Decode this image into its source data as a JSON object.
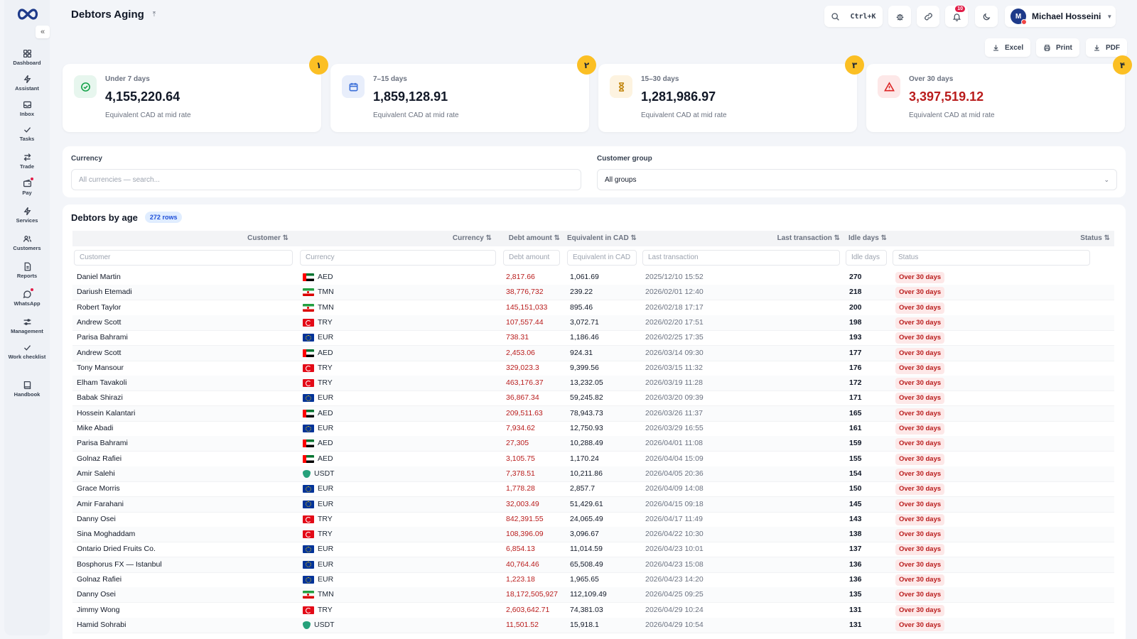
{
  "sidebar": {
    "collapse_glyph": "«",
    "items": [
      {
        "label": "Dashboard",
        "icon": "dashboard-icon",
        "dot": false
      },
      {
        "label": "Assistant",
        "icon": "bolt-icon",
        "dot": false
      },
      {
        "label": "Inbox",
        "icon": "inbox-icon",
        "dot": false
      },
      {
        "label": "Tasks",
        "icon": "check-icon",
        "dot": false
      },
      {
        "label": "Trade",
        "icon": "swap-icon",
        "dot": false
      },
      {
        "label": "Pay",
        "icon": "wallet-icon",
        "dot": true
      },
      {
        "label": "Services",
        "icon": "bolt-icon",
        "dot": false
      },
      {
        "label": "Customers",
        "icon": "users-icon",
        "dot": false
      },
      {
        "label": "Reports",
        "icon": "report-icon",
        "dot": false
      },
      {
        "label": "WhatsApp",
        "icon": "chat-icon",
        "dot": true
      },
      {
        "label": "Management",
        "icon": "sliders-icon",
        "dot": false
      },
      {
        "label": "Work checklist",
        "icon": "check-icon",
        "dot": false
      },
      {
        "label": "Handbook",
        "icon": "book-icon",
        "dot": false
      }
    ]
  },
  "header": {
    "title": "Debtors Aging",
    "search_shortcut": "Ctrl+K",
    "notifications_count": "10",
    "user_initial": "M",
    "user_name": "Michael Hosseini"
  },
  "exports": {
    "excel": "Excel",
    "print": "Print",
    "pdf": "PDF"
  },
  "cards": [
    {
      "badge": "١",
      "label": "Under 7 days",
      "value": "4,155,220.64",
      "sub": "Equivalent CAD at mid rate",
      "icon": "check-circle-icon",
      "accent": "#16a34a",
      "bg": "#e7f6ee",
      "red": false
    },
    {
      "badge": "٢",
      "label": "7–15 days",
      "value": "1,859,128.91",
      "sub": "Equivalent CAD at mid rate",
      "icon": "calendar-icon",
      "accent": "#3b6fd8",
      "bg": "#e8eefb",
      "red": false
    },
    {
      "badge": "٣",
      "label": "15–30 days",
      "value": "1,281,986.97",
      "sub": "Equivalent CAD at mid rate",
      "icon": "hourglass-icon",
      "accent": "#c2860e",
      "bg": "#fdf3e0",
      "red": false
    },
    {
      "badge": "۴",
      "label": "Over 30 days",
      "value": "3,397,519.12",
      "sub": "Equivalent CAD at mid rate",
      "icon": "warning-icon",
      "accent": "#dc2626",
      "bg": "#fde8e8",
      "red": true
    }
  ],
  "filters": {
    "currency_label": "Currency",
    "currency_placeholder": "All currencies — search...",
    "group_label": "Customer group",
    "group_value": "All groups"
  },
  "table": {
    "title": "Debtors by age",
    "rows_count": "272 rows",
    "columns": {
      "customer": "Customer ⇅",
      "currency": "Currency ⇅",
      "debt": "Debt amount ⇅",
      "equiv": "Equivalent in CAD ⇅",
      "last": "Last transaction ⇅",
      "idle": "Idle days ⇅",
      "status": "Status ⇅"
    },
    "filter_placeholders": {
      "customer": "Customer",
      "currency": "Currency",
      "debt": "Debt amount",
      "equiv": "Equivalent in CAD",
      "last": "Last transaction",
      "idle": "Idle days",
      "status": "Status"
    },
    "rows": [
      {
        "customer": "Daniel Martin",
        "currency": "AED",
        "flag": "aed",
        "debt": "2,817.66",
        "equiv": "1,061.69",
        "last": "2025/12/10 15:52",
        "idle": "270",
        "status": "Over 30 days"
      },
      {
        "customer": "Dariush Etemadi",
        "currency": "TMN",
        "flag": "tmn",
        "debt": "38,776,732",
        "equiv": "239.22",
        "last": "2026/02/01 12:40",
        "idle": "218",
        "status": "Over 30 days"
      },
      {
        "customer": "Robert Taylor",
        "currency": "TMN",
        "flag": "tmn",
        "debt": "145,151,033",
        "equiv": "895.46",
        "last": "2026/02/18 17:17",
        "idle": "200",
        "status": "Over 30 days"
      },
      {
        "customer": "Andrew Scott",
        "currency": "TRY",
        "flag": "try",
        "debt": "107,557.44",
        "equiv": "3,072.71",
        "last": "2026/02/20 17:51",
        "idle": "198",
        "status": "Over 30 days"
      },
      {
        "customer": "Parisa Bahrami",
        "currency": "EUR",
        "flag": "eur",
        "debt": "738.31",
        "equiv": "1,186.46",
        "last": "2026/02/25 17:35",
        "idle": "193",
        "status": "Over 30 days"
      },
      {
        "customer": "Andrew Scott",
        "currency": "AED",
        "flag": "aed",
        "debt": "2,453.06",
        "equiv": "924.31",
        "last": "2026/03/14 09:30",
        "idle": "177",
        "status": "Over 30 days"
      },
      {
        "customer": "Tony Mansour",
        "currency": "TRY",
        "flag": "try",
        "debt": "329,023.3",
        "equiv": "9,399.56",
        "last": "2026/03/15 11:32",
        "idle": "176",
        "status": "Over 30 days"
      },
      {
        "customer": "Elham Tavakoli",
        "currency": "TRY",
        "flag": "try",
        "debt": "463,176.37",
        "equiv": "13,232.05",
        "last": "2026/03/19 11:28",
        "idle": "172",
        "status": "Over 30 days"
      },
      {
        "customer": "Babak Shirazi",
        "currency": "EUR",
        "flag": "eur",
        "debt": "36,867.34",
        "equiv": "59,245.82",
        "last": "2026/03/20 09:39",
        "idle": "171",
        "status": "Over 30 days"
      },
      {
        "customer": "Hossein Kalantari",
        "currency": "AED",
        "flag": "aed",
        "debt": "209,511.63",
        "equiv": "78,943.73",
        "last": "2026/03/26 11:37",
        "idle": "165",
        "status": "Over 30 days"
      },
      {
        "customer": "Mike Abadi",
        "currency": "EUR",
        "flag": "eur",
        "debt": "7,934.62",
        "equiv": "12,750.93",
        "last": "2026/03/29 16:55",
        "idle": "161",
        "status": "Over 30 days"
      },
      {
        "customer": "Parisa Bahrami",
        "currency": "AED",
        "flag": "aed",
        "debt": "27,305",
        "equiv": "10,288.49",
        "last": "2026/04/01 11:08",
        "idle": "159",
        "status": "Over 30 days"
      },
      {
        "customer": "Golnaz Rafiei",
        "currency": "AED",
        "flag": "aed",
        "debt": "3,105.75",
        "equiv": "1,170.24",
        "last": "2026/04/04 15:09",
        "idle": "155",
        "status": "Over 30 days"
      },
      {
        "customer": "Amir Salehi",
        "currency": "USDT",
        "flag": "usdt",
        "debt": "7,378.51",
        "equiv": "10,211.86",
        "last": "2026/04/05 20:36",
        "idle": "154",
        "status": "Over 30 days"
      },
      {
        "customer": "Grace Morris",
        "currency": "EUR",
        "flag": "eur",
        "debt": "1,778.28",
        "equiv": "2,857.7",
        "last": "2026/04/09 14:08",
        "idle": "150",
        "status": "Over 30 days"
      },
      {
        "customer": "Amir Farahani",
        "currency": "EUR",
        "flag": "eur",
        "debt": "32,003.49",
        "equiv": "51,429.61",
        "last": "2026/04/15 09:18",
        "idle": "145",
        "status": "Over 30 days"
      },
      {
        "customer": "Danny Osei",
        "currency": "TRY",
        "flag": "try",
        "debt": "842,391.55",
        "equiv": "24,065.49",
        "last": "2026/04/17 11:49",
        "idle": "143",
        "status": "Over 30 days"
      },
      {
        "customer": "Sina Moghaddam",
        "currency": "TRY",
        "flag": "try",
        "debt": "108,396.09",
        "equiv": "3,096.67",
        "last": "2026/04/22 10:30",
        "idle": "138",
        "status": "Over 30 days"
      },
      {
        "customer": "Ontario Dried Fruits Co.",
        "currency": "EUR",
        "flag": "eur",
        "debt": "6,854.13",
        "equiv": "11,014.59",
        "last": "2026/04/23 10:01",
        "idle": "137",
        "status": "Over 30 days"
      },
      {
        "customer": "Bosphorus FX — Istanbul",
        "currency": "EUR",
        "flag": "eur",
        "debt": "40,764.46",
        "equiv": "65,508.49",
        "last": "2026/04/23 15:08",
        "idle": "136",
        "status": "Over 30 days"
      },
      {
        "customer": "Golnaz Rafiei",
        "currency": "EUR",
        "flag": "eur",
        "debt": "1,223.18",
        "equiv": "1,965.65",
        "last": "2026/04/23 14:20",
        "idle": "136",
        "status": "Over 30 days"
      },
      {
        "customer": "Danny Osei",
        "currency": "TMN",
        "flag": "tmn",
        "debt": "18,172,505,927",
        "equiv": "112,109.49",
        "last": "2026/04/25 09:25",
        "idle": "135",
        "status": "Over 30 days"
      },
      {
        "customer": "Jimmy Wong",
        "currency": "TRY",
        "flag": "try",
        "debt": "2,603,642.71",
        "equiv": "74,381.03",
        "last": "2026/04/29 10:24",
        "idle": "131",
        "status": "Over 30 days"
      },
      {
        "customer": "Hamid Sohrabi",
        "currency": "USDT",
        "flag": "usdt",
        "debt": "11,501.52",
        "equiv": "15,918.1",
        "last": "2026/04/29 10:54",
        "idle": "131",
        "status": "Over 30 days"
      }
    ]
  }
}
